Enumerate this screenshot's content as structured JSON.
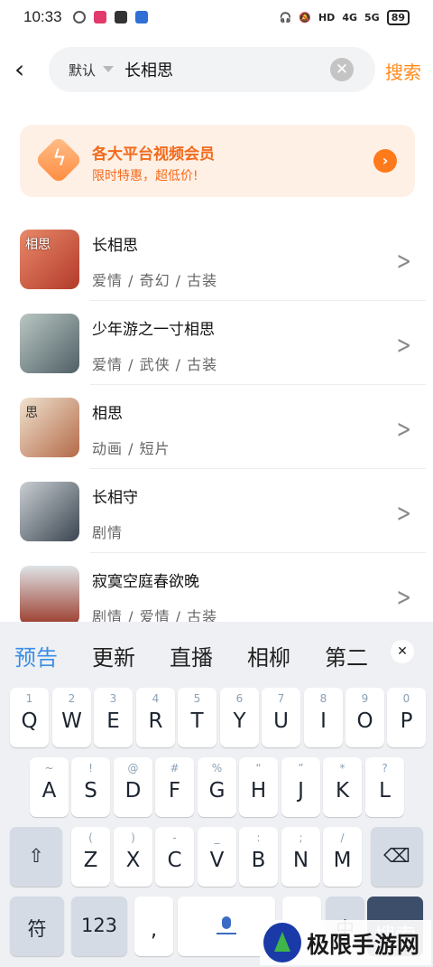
{
  "status_bar": {
    "time": "10:33",
    "network": "4G",
    "network2": "5G",
    "hd": "HD",
    "battery": "89"
  },
  "search": {
    "back_icon": "back-arrow-icon",
    "scope": "默认",
    "query": "长相思",
    "clear_icon": "clear-icon",
    "button": "搜索"
  },
  "promo": {
    "title": "各大平台视频会员",
    "subtitle": "限时特惠，超低价!",
    "icon": "diamond-bolt-icon"
  },
  "results": [
    {
      "title": "长相思",
      "tags": "爱情 / 奇幻 / 古装",
      "thumb_text": "相思",
      "thumb_color": "#c8553d"
    },
    {
      "title": "少年游之一寸相思",
      "tags": "爱情 / 武侠 / 古装",
      "thumb_text": "",
      "thumb_color": "#7b8c8a"
    },
    {
      "title": "相思",
      "tags": "动画 / 短片",
      "thumb_text": "思",
      "thumb_color": "#d9b38f"
    },
    {
      "title": "长相守",
      "tags": "剧情",
      "thumb_text": "",
      "thumb_color": "#5a6670"
    },
    {
      "title": "寂寞空庭春欲晚",
      "tags": "剧情 / 爱情 / 古装",
      "thumb_text": "",
      "thumb_color": "#8d3b2c"
    }
  ],
  "keyboard": {
    "candidates": [
      "预告",
      "更新",
      "直播",
      "相柳",
      "第二"
    ],
    "row1": [
      {
        "hint": "1",
        "key": "Q"
      },
      {
        "hint": "2",
        "key": "W"
      },
      {
        "hint": "3",
        "key": "E"
      },
      {
        "hint": "4",
        "key": "R"
      },
      {
        "hint": "5",
        "key": "T"
      },
      {
        "hint": "6",
        "key": "Y"
      },
      {
        "hint": "7",
        "key": "U"
      },
      {
        "hint": "8",
        "key": "I"
      },
      {
        "hint": "9",
        "key": "O"
      },
      {
        "hint": "0",
        "key": "P"
      }
    ],
    "row2": [
      {
        "hint": "~",
        "key": "A"
      },
      {
        "hint": "!",
        "key": "S"
      },
      {
        "hint": "@",
        "key": "D"
      },
      {
        "hint": "#",
        "key": "F"
      },
      {
        "hint": "%",
        "key": "G"
      },
      {
        "hint": "“",
        "key": "H"
      },
      {
        "hint": "”",
        "key": "J"
      },
      {
        "hint": "*",
        "key": "K"
      },
      {
        "hint": "?",
        "key": "L"
      }
    ],
    "row3": [
      {
        "hint": "(",
        "key": "Z"
      },
      {
        "hint": ")",
        "key": "X"
      },
      {
        "hint": "-",
        "key": "C"
      },
      {
        "hint": "_",
        "key": "V"
      },
      {
        "hint": ":",
        "key": "B"
      },
      {
        "hint": ";",
        "key": "N"
      },
      {
        "hint": "/",
        "key": "M"
      }
    ],
    "shift": "⇧",
    "backspace": "⌫",
    "symbols": "符",
    "numbers": "123",
    "comma": ",",
    "lang": "中",
    "go": "搜索"
  },
  "watermark": "极限手游网"
}
